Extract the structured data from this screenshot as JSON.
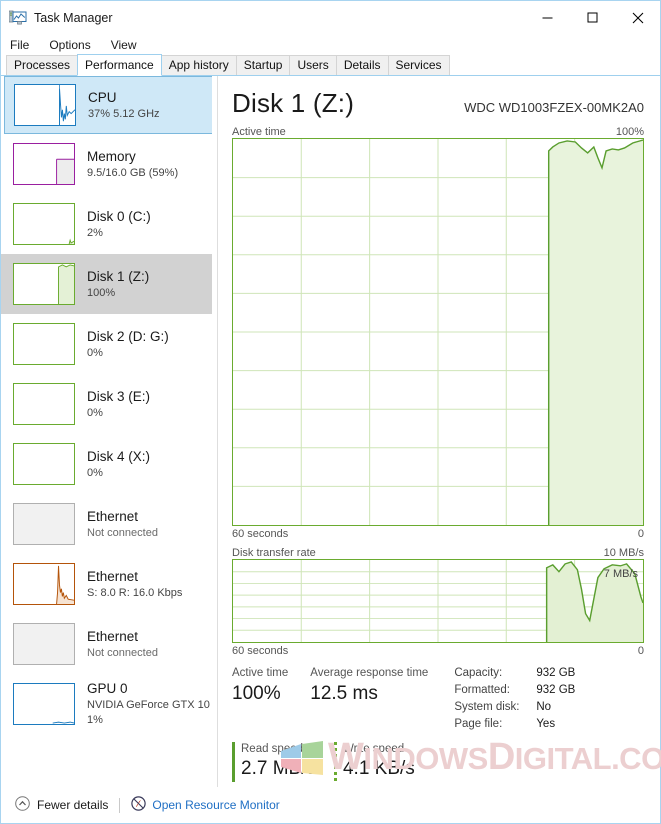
{
  "window": {
    "title": "Task Manager",
    "icon": "task-manager-icon",
    "minimize": "—",
    "maximize": "□",
    "close": "✕"
  },
  "menu": {
    "items": [
      "File",
      "Options",
      "View"
    ]
  },
  "tabs": {
    "items": [
      "Processes",
      "Performance",
      "App history",
      "Startup",
      "Users",
      "Details",
      "Services"
    ],
    "active": "Performance"
  },
  "sidebar": {
    "items": [
      {
        "title": "CPU",
        "sub": "37%  5.12 GHz",
        "state": "focused",
        "color": "#1c7bbf"
      },
      {
        "title": "Memory",
        "sub": "9.5/16.0 GB (59%)",
        "state": "normal",
        "color": "#9a1fa0"
      },
      {
        "title": "Disk 0 (C:)",
        "sub": "2%",
        "state": "normal",
        "color": "#6aab2f"
      },
      {
        "title": "Disk 1 (Z:)",
        "sub": "100%",
        "state": "selected",
        "color": "#6aab2f"
      },
      {
        "title": "Disk 2 (D: G:)",
        "sub": "0%",
        "state": "normal",
        "color": "#6aab2f"
      },
      {
        "title": "Disk 3 (E:)",
        "sub": "0%",
        "state": "normal",
        "color": "#6aab2f"
      },
      {
        "title": "Disk 4 (X:)",
        "sub": "0%",
        "state": "normal",
        "color": "#6aab2f"
      },
      {
        "title": "Ethernet",
        "sub": "Not connected",
        "state": "disabled",
        "color": "#b0b0b0"
      },
      {
        "title": "Ethernet",
        "sub": "S: 8.0 R: 16.0 Kbps",
        "state": "normal",
        "color": "#b4540a"
      },
      {
        "title": "Ethernet",
        "sub": "Not connected",
        "state": "disabled",
        "color": "#b0b0b0"
      },
      {
        "title": "GPU 0",
        "sub": "NVIDIA GeForce GTX 10",
        "sub2": "1%",
        "state": "normal",
        "color": "#1c7bbf"
      }
    ]
  },
  "main": {
    "title": "Disk 1 (Z:)",
    "model": "WDC WD1003FZEX-00MK2A0",
    "active_graph": {
      "label": "Active time",
      "max": "100%",
      "left_axis": "60 seconds",
      "right_axis": "0"
    },
    "rate_graph": {
      "label": "Disk transfer rate",
      "max": "10 MB/s",
      "annotation": "7 MB/s",
      "left_axis": "60 seconds",
      "right_axis": "0"
    },
    "stats": {
      "active_time_label": "Active time",
      "active_time_value": "100%",
      "response_label": "Average response time",
      "response_value": "12.5 ms",
      "read_label": "Read speed",
      "read_value": "2.7 MB/s",
      "write_label": "Write speed",
      "write_value": "4.1 KB/s"
    },
    "info": [
      {
        "key": "Capacity:",
        "value": "932 GB"
      },
      {
        "key": "Formatted:",
        "value": "932 GB"
      },
      {
        "key": "System disk:",
        "value": "No"
      },
      {
        "key": "Page file:",
        "value": "Yes"
      }
    ]
  },
  "watermark": {
    "text_a": "W",
    "text_b": "INDOWS",
    "text_c": "D",
    "text_d": "IGITAL.COM"
  },
  "footer": {
    "fewer_details": "Fewer details",
    "resource_monitor": "Open Resource Monitor"
  },
  "chart_data": [
    {
      "type": "area",
      "title": "Active time",
      "ylabel": "Active time",
      "xlabel": "60 seconds",
      "ylim": [
        0,
        100
      ],
      "xlim": [
        60,
        0
      ],
      "grid": true,
      "grid_cols": 6,
      "grid_rows": 10,
      "y_max_label": "100%",
      "x_left_label": "60 seconds",
      "x_right_label": "0",
      "x": [
        60,
        48,
        40,
        33,
        28,
        24,
        22,
        20,
        18,
        17,
        16.5,
        16,
        15,
        14,
        13,
        12,
        11,
        10,
        9,
        8,
        7,
        6,
        5,
        4,
        3,
        2,
        1,
        0
      ],
      "values": [
        0,
        0,
        0,
        0,
        0,
        0,
        0,
        0,
        0,
        0,
        0,
        0,
        97,
        100,
        100,
        99,
        97,
        94,
        96,
        92,
        83,
        90,
        92,
        91,
        93,
        97,
        99,
        100
      ]
    },
    {
      "type": "area",
      "title": "Disk transfer rate",
      "ylabel": "Disk transfer rate",
      "xlabel": "60 seconds",
      "ylim": [
        0,
        10
      ],
      "xlim": [
        60,
        0
      ],
      "grid": true,
      "grid_cols": 6,
      "grid_rows": 7,
      "y_max_label": "10 MB/s",
      "annotation": "7 MB/s",
      "x_left_label": "60 seconds",
      "x_right_label": "0",
      "x": [
        60,
        40,
        30,
        20,
        17,
        16,
        15,
        14,
        13,
        12,
        11,
        10,
        9,
        8,
        7,
        6,
        5,
        4,
        3,
        2,
        1,
        0
      ],
      "values": [
        0,
        0,
        0,
        0,
        0,
        0,
        9.4,
        9.9,
        8.6,
        9.3,
        9.6,
        4.2,
        2.5,
        6.8,
        7.8,
        7.6,
        9.0,
        9.4,
        9.3,
        9.0,
        5.6,
        4.5
      ]
    }
  ]
}
